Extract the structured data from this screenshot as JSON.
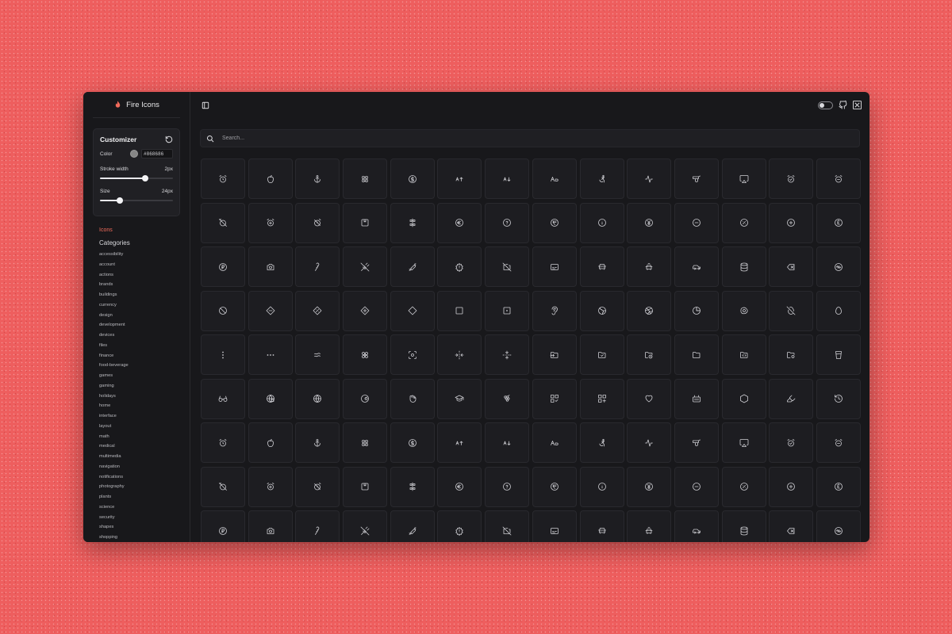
{
  "app": {
    "name": "Fire Icons",
    "accent": "#f26b5b"
  },
  "customizer": {
    "title": "Customizer",
    "color_label": "Color",
    "color_value": "#868686",
    "stroke_label": "Stroke width",
    "stroke_value": "2px",
    "stroke_fraction": 0.62,
    "size_label": "Size",
    "size_value": "24px",
    "size_fraction": 0.27
  },
  "nav": {
    "icons_label": "Icons",
    "categories_label": "Categories",
    "categories": [
      "accessibility",
      "account",
      "actions",
      "brands",
      "buildings",
      "currency",
      "design",
      "development",
      "devices",
      "files",
      "finance",
      "food-beverage",
      "games",
      "gaming",
      "holidays",
      "home",
      "interface",
      "layout",
      "math",
      "medical",
      "multimedia",
      "navigation",
      "notifications",
      "photography",
      "plants",
      "science",
      "security",
      "shapes",
      "shopping"
    ]
  },
  "search": {
    "placeholder": "Search..."
  },
  "icon_rows": [
    [
      "alarm-clock",
      "apple",
      "anchor",
      "atom",
      "badge-dollar",
      "arrow-up-a",
      "arrow-down-a",
      "text-aa",
      "accessibility",
      "activity",
      "fire-extinguisher",
      "airplay",
      "alarm-check",
      "alarm-minus"
    ],
    [
      "alarm-off",
      "alarm-plus",
      "alarm-clock-off",
      "archive",
      "align-center",
      "badge-euro",
      "badge-help",
      "badge-indian-rupee",
      "badge-info",
      "badge-japanese-yen",
      "badge-minus",
      "badge-percent",
      "badge-plus",
      "badge-pound"
    ],
    [
      "badge-ruble",
      "camera",
      "candy-cane",
      "carrot-off",
      "candy",
      "badge-alert",
      "camera-off",
      "captions",
      "car-front",
      "car-taxi",
      "car",
      "database",
      "delete",
      "audio-waveform"
    ],
    [
      "ban",
      "diamond-minus",
      "diamond-percent",
      "diamond-plus",
      "diamond",
      "square",
      "square-dot",
      "ear",
      "earth",
      "dribbble",
      "pie-chart",
      "egg-fried",
      "egg-off",
      "egg"
    ],
    [
      "more-vertical",
      "more-horizontal",
      "equal-approximately",
      "flower",
      "focus",
      "fold-horizontal",
      "fold-vertical",
      "folder-input",
      "folder-check",
      "folder-clock",
      "folder",
      "folder-code",
      "folder-cog",
      "glass-water"
    ],
    [
      "glasses",
      "globe-lock",
      "globe",
      "gauge",
      "grab",
      "graduation-cap",
      "grape",
      "layout-grid-check",
      "layout-grid-plus",
      "heart",
      "heater",
      "hexagon",
      "highlighter",
      "history"
    ],
    [
      "alarm-clock",
      "apple",
      "anchor",
      "atom",
      "badge-dollar",
      "arrow-up-a",
      "arrow-down-a",
      "text-aa",
      "accessibility",
      "activity",
      "fire-extinguisher",
      "airplay",
      "alarm-check",
      "alarm-minus"
    ],
    [
      "alarm-off",
      "alarm-plus",
      "alarm-clock-off",
      "archive",
      "align-center",
      "badge-euro",
      "badge-help",
      "badge-indian-rupee",
      "badge-info",
      "badge-japanese-yen",
      "badge-minus",
      "badge-percent",
      "badge-plus",
      "badge-pound"
    ],
    [
      "badge-ruble",
      "camera",
      "candy-cane",
      "carrot-off",
      "candy",
      "badge-alert",
      "camera-off",
      "captions",
      "car-front",
      "car-taxi",
      "car",
      "database",
      "delete",
      "audio-waveform"
    ]
  ]
}
